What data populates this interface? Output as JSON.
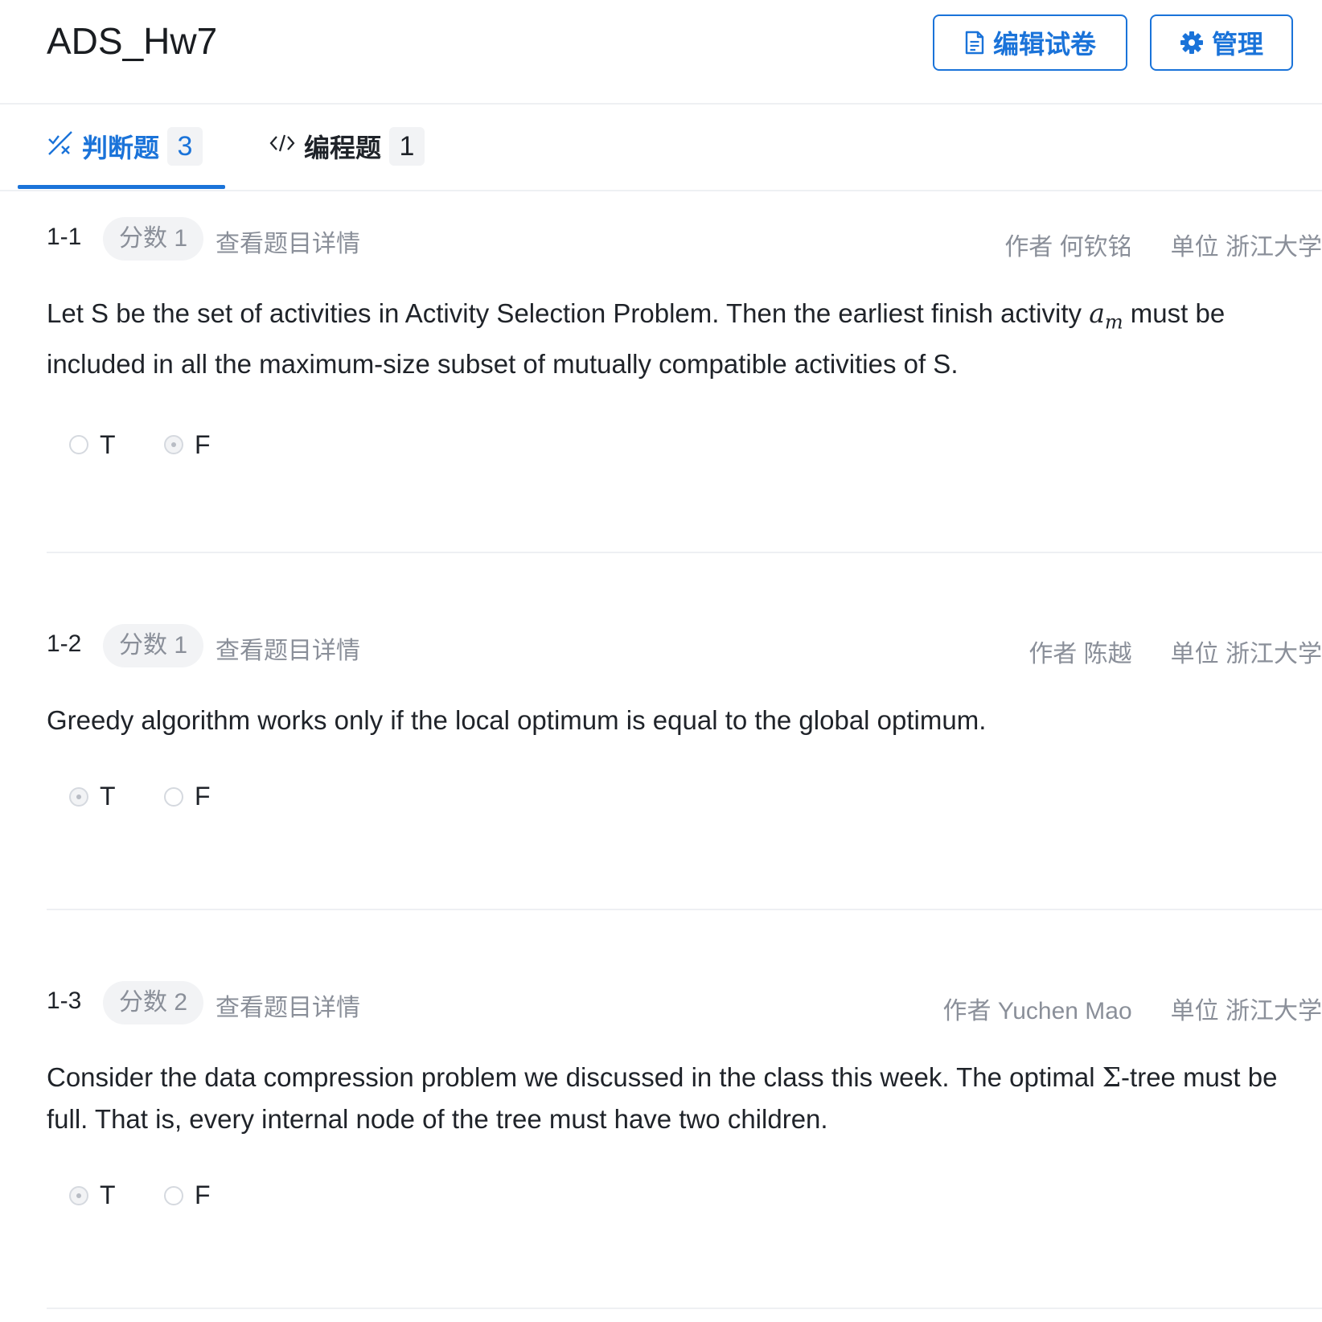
{
  "header": {
    "title": "ADS_Hw7",
    "edit_button": "编辑试卷",
    "manage_button": "管理",
    "edit_icon": "document-icon",
    "manage_icon": "gear-icon"
  },
  "tabs": [
    {
      "label": "判断题",
      "count": "3",
      "icon": "true-false-icon",
      "active": true
    },
    {
      "label": "编程题",
      "count": "1",
      "icon": "code-icon",
      "active": false
    }
  ],
  "questions": [
    {
      "number": "1-1",
      "score": "分数 1",
      "detail_link": "查看题目详情",
      "author": "作者 何钦铭",
      "unit": "单位 浙江大学",
      "text_before": "Let S be the set of activities in Activity Selection Problem. Then the earliest finish activity ",
      "math": "a",
      "math_sub": "m",
      "text_after": " must be included in all the maximum-size subset of mutually compatible activities of S.",
      "options": [
        "T",
        "F"
      ],
      "selected": "F"
    },
    {
      "number": "1-2",
      "score": "分数 1",
      "detail_link": "查看题目详情",
      "author": "作者 陈越",
      "unit": "单位 浙江大学",
      "text": "Greedy algorithm works only if the local optimum is equal to the global optimum.",
      "options": [
        "T",
        "F"
      ],
      "selected": "T"
    },
    {
      "number": "1-3",
      "score": "分数 2",
      "detail_link": "查看题目详情",
      "author": "作者 Yuchen Mao",
      "unit": "单位 浙江大学",
      "text_before": "Consider the data compression problem we discussed in the class this week. The optimal ",
      "math": "Σ",
      "text_after": "-tree must be full. That is, every internal node of the tree must have two children.",
      "options": [
        "T",
        "F"
      ],
      "selected": "T"
    }
  ]
}
